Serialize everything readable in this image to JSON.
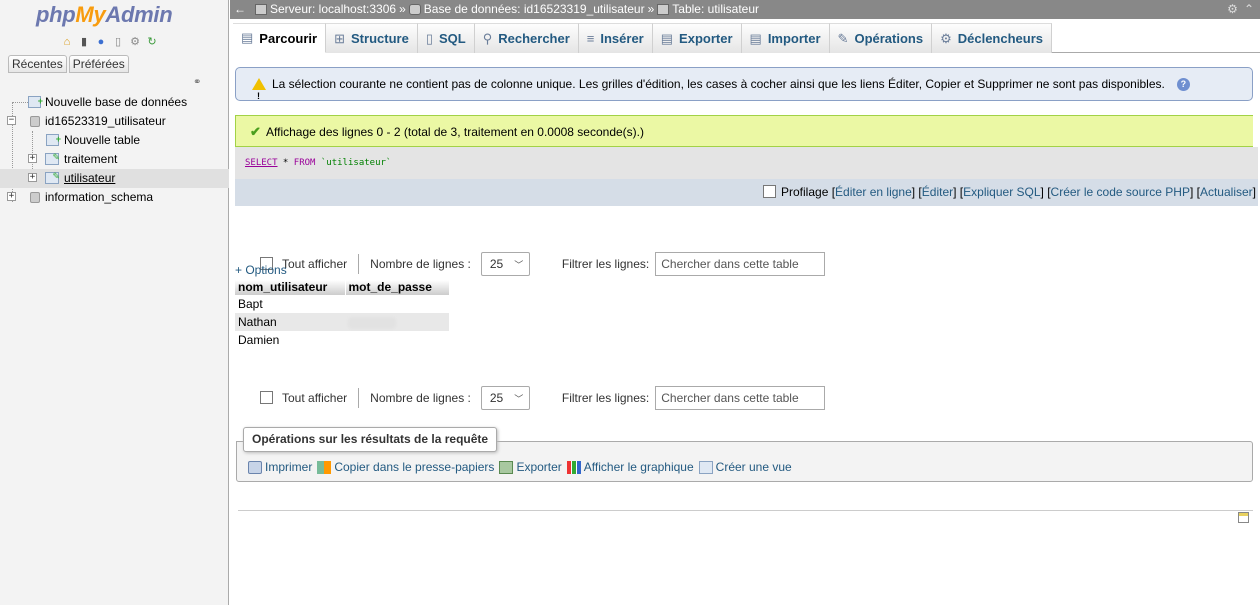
{
  "nav": {
    "logo_php": "php",
    "logo_my": "My",
    "logo_admin": "Admin",
    "tabs": [
      "Récentes",
      "Préférées"
    ],
    "icons": [
      "home-icon",
      "exit-icon",
      "help-icon",
      "docs-icon",
      "settings-icon",
      "reload-icon"
    ],
    "tree": {
      "new_db": "Nouvelle base de données",
      "db1": "id16523319_utilisateur",
      "new_table": "Nouvelle table",
      "table1": "traitement",
      "table2": "utilisateur",
      "db2": "information_schema"
    }
  },
  "topbar": {
    "server": "Serveur: localhost:3306",
    "database": "Base de données: id16523319_utilisateur",
    "table": "Table: utilisateur",
    "separator": "»"
  },
  "tabs": [
    {
      "label": "Parcourir",
      "icon": "browse-icon",
      "glyph": "▤"
    },
    {
      "label": "Structure",
      "icon": "structure-icon",
      "glyph": "⊞"
    },
    {
      "label": "SQL",
      "icon": "sql-icon",
      "glyph": "▯"
    },
    {
      "label": "Rechercher",
      "icon": "search-icon",
      "glyph": "🔍"
    },
    {
      "label": "Insérer",
      "icon": "insert-icon",
      "glyph": "≡"
    },
    {
      "label": "Exporter",
      "icon": "export-icon",
      "glyph": "▤"
    },
    {
      "label": "Importer",
      "icon": "import-icon",
      "glyph": "▤"
    },
    {
      "label": "Opérations",
      "icon": "wrench-icon",
      "glyph": "🔧"
    },
    {
      "label": "Déclencheurs",
      "icon": "triggers-icon",
      "glyph": "⚙"
    }
  ],
  "notice": {
    "text": "La sélection courante ne contient pas de colonne unique. Les grilles d'édition, les cases à cocher ainsi que les liens Éditer, Copier et Supprimer ne sont pas disponibles."
  },
  "success": {
    "text": "Affichage des lignes 0 - 2 (total de 3, traitement en 0.0008 seconde(s).)"
  },
  "sql": {
    "select": "SELECT",
    "star": " * ",
    "from": "FROM",
    "table": " `utilisateur`"
  },
  "profbar": {
    "profiling": "Profilage",
    "links": [
      "Éditer en ligne",
      "Éditer",
      "Expliquer SQL",
      "Créer le code source PHP",
      "Actualiser"
    ]
  },
  "navrow": {
    "show_all": "Tout afficher",
    "rows_label": "Nombre de lignes :",
    "rows_value": "25",
    "filter_label": "Filtrer les lignes:",
    "filter_placeholder": "Chercher dans cette table"
  },
  "results": {
    "options_link": "+ Options",
    "columns": [
      "nom_utilisateur",
      "mot_de_passe"
    ],
    "rows": [
      [
        "Bapt",
        ""
      ],
      [
        "Nathan",
        ""
      ],
      [
        "Damien",
        ""
      ]
    ]
  },
  "query_ops": {
    "legend": "Opérations sur les résultats de la requête",
    "links": [
      "Imprimer",
      "Copier dans le presse-papiers",
      "Exporter",
      "Afficher le graphique",
      "Créer une vue"
    ]
  }
}
